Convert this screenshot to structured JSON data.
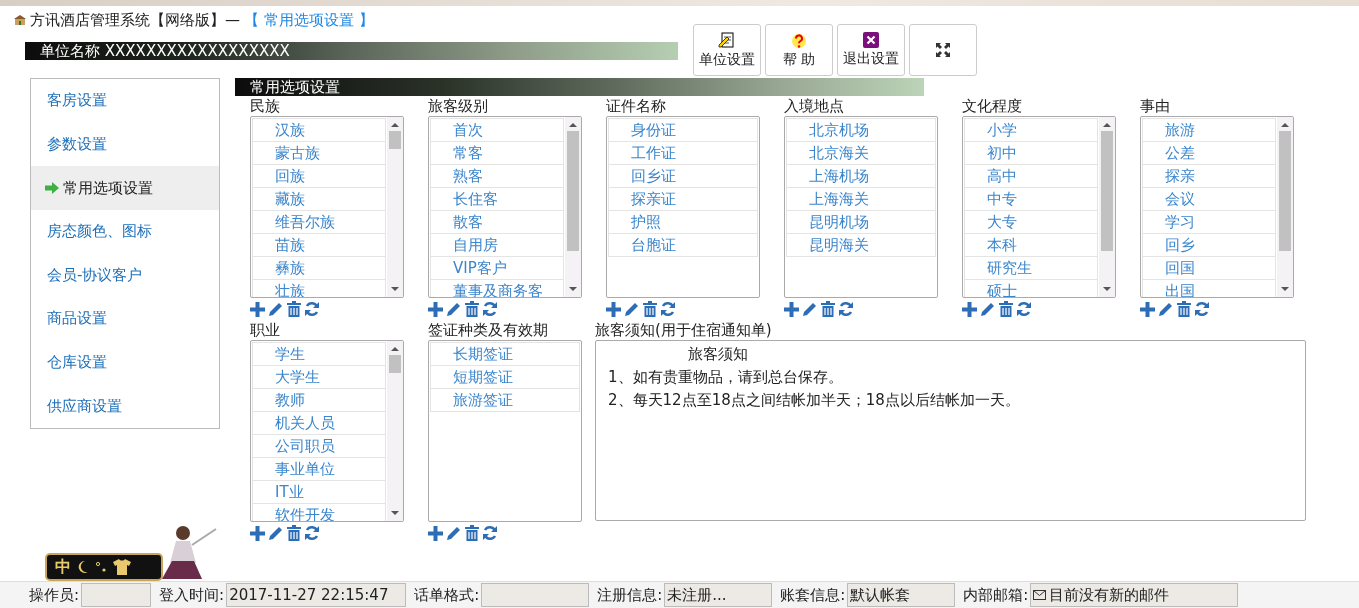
{
  "window": {
    "title": "方讯酒店管理系统【网络版】—",
    "page": "【 常用选项设置 】"
  },
  "unit_bar": {
    "label": "单位名称",
    "value": "XXXXXXXXXXXXXXXXXX"
  },
  "toolbar": [
    {
      "kind": "doc",
      "label": "单位设置"
    },
    {
      "kind": "help",
      "label": "帮 助"
    },
    {
      "kind": "exit",
      "label": "退出设置"
    },
    {
      "kind": "fullscreen"
    }
  ],
  "sidebar": {
    "items": [
      {
        "label": "客房设置",
        "selected": false
      },
      {
        "label": "参数设置",
        "selected": false
      },
      {
        "label": "常用选项设置",
        "selected": true
      },
      {
        "label": "房态颜色、图标",
        "selected": false
      },
      {
        "label": "会员-协议客户",
        "selected": false
      },
      {
        "label": "商品设置",
        "selected": false
      },
      {
        "label": "仓库设置",
        "selected": false
      },
      {
        "label": "供应商设置",
        "selected": false
      }
    ]
  },
  "section_title": "常用选项设置",
  "lists": [
    {
      "title": "民族",
      "scrollbar": true,
      "items": [
        "汉族",
        "蒙古族",
        "回族",
        "藏族",
        "维吾尔族",
        "苗族",
        "彝族",
        "壮族"
      ]
    },
    {
      "title": "旅客级别",
      "scrollbar": true,
      "items": [
        "首次",
        "常客",
        "熟客",
        "长住客",
        "散客",
        "自用房",
        "VIP客户",
        "董事及商务客"
      ]
    },
    {
      "title": "证件名称",
      "scrollbar": false,
      "items": [
        "身份证",
        "工作证",
        "回乡证",
        "探亲证",
        "护照",
        "台胞证"
      ]
    },
    {
      "title": "入境地点",
      "scrollbar": false,
      "items": [
        "北京机场",
        "北京海关",
        "上海机场",
        "上海海关",
        "昆明机场",
        "昆明海关"
      ]
    },
    {
      "title": "文化程度",
      "scrollbar": true,
      "items": [
        "小学",
        "初中",
        "高中",
        "中专",
        "大专",
        "本科",
        "研究生",
        "硕士"
      ]
    },
    {
      "title": "事由",
      "scrollbar": true,
      "items": [
        "旅游",
        "公差",
        "探亲",
        "会议",
        "学习",
        "回乡",
        "回国",
        "出国"
      ]
    },
    {
      "title": "职业",
      "scrollbar": true,
      "items": [
        "学生",
        "大学生",
        "教师",
        "机关人员",
        "公司职员",
        "事业单位",
        "IT业",
        "软件开发"
      ]
    },
    {
      "title": "签证种类及有效期",
      "scrollbar": false,
      "items": [
        "长期签证",
        "短期签证",
        "旅游签证"
      ]
    }
  ],
  "notice": {
    "label": "旅客须知(用于住宿通知单)",
    "heading": "旅客须知",
    "lines": [
      "1、如有贵重物品，请到总台保存。",
      "2、每天12点至18点之间结帐加半天；18点以后结帐加一天。"
    ]
  },
  "ime_bar": {
    "text": "中"
  },
  "status_bar": [
    {
      "label": "操作员:",
      "mail": false
    },
    {
      "label": "登入时间:",
      "value": "2017-11-27 22:15:47",
      "mail": false
    },
    {
      "label": "话单格式:",
      "mail": false
    },
    {
      "label": "注册信息:",
      "value": "未注册...",
      "mail": false
    },
    {
      "label": "账套信息:",
      "value": "默认帐套",
      "mail": false
    },
    {
      "label": "内部邮箱:",
      "value": "目前没有新的邮件",
      "mail": true
    }
  ]
}
